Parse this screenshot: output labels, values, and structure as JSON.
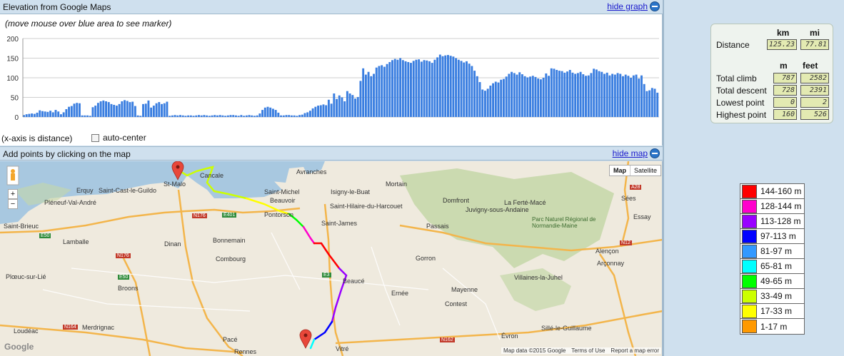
{
  "elevation_panel": {
    "title": "Elevation from Google Maps",
    "hide_link": "hide graph",
    "hint": "(move mouse over blue area to see marker)",
    "xaxis_note": "(x-axis is distance)",
    "autocenter_label": "auto-center",
    "autocenter_checked": false
  },
  "map_panel": {
    "title": "Add points by clicking on the map",
    "hide_link": "hide map",
    "map_type_buttons": [
      "Map",
      "Satellite"
    ],
    "attribution": [
      "Map data ©2015 Google",
      "Terms of Use",
      "Report a map error"
    ],
    "google_logo": "Google",
    "zoom_in": "+",
    "zoom_out": "−",
    "place_labels": [
      "St-Malo",
      "Cancale",
      "Avranches",
      "Mortain",
      "Erquy",
      "Saint-Cast-le-Guildo",
      "Pléneuf-Val-André",
      "Saint-Michel",
      "Beauvoir",
      "Isigny-le-Buat",
      "Saint-Hilaire-du-Harcouet",
      "Domfront",
      "La Ferté-Macé",
      "Juvigny-sous-Andaine",
      "Parc Naturel Régional de Normandie-Maine",
      "Sées",
      "Essay",
      "Saint-Brieuc",
      "Lamballe",
      "Dinan",
      "Bonnemain",
      "Pontorson",
      "Saint-James",
      "Passais",
      "Combourg",
      "Gorron",
      "Alençon",
      "Arçonnay",
      "Plœuc-sur-Lié",
      "Broons",
      "Beaucé",
      "Ernée",
      "Villaines-la-Juhel",
      "Mayenne",
      "Contest",
      "Loudéac",
      "Merdrignac",
      "Pacé",
      "Rennes",
      "Vitré",
      "Évron",
      "Sillé-le-Guillaume"
    ],
    "road_labels": [
      "N176",
      "E401",
      "E50",
      "N176",
      "E50",
      "N164",
      "E3",
      "N162",
      "A28",
      "N12"
    ]
  },
  "stats": {
    "headers1": [
      "km",
      "mi"
    ],
    "distance_label": "Distance",
    "distance_km": "125.23",
    "distance_mi": "77.81",
    "headers2": [
      "m",
      "feet"
    ],
    "rows": [
      {
        "label": "Total climb",
        "m": "787",
        "feet": "2582"
      },
      {
        "label": "Total descent",
        "m": "728",
        "feet": "2391"
      },
      {
        "label": "Lowest point",
        "m": "0",
        "feet": "2"
      },
      {
        "label": "Highest point",
        "m": "160",
        "feet": "526"
      }
    ]
  },
  "legend": [
    {
      "label": "144-160 m",
      "color": "#ff0000"
    },
    {
      "label": "128-144 m",
      "color": "#ff00cc"
    },
    {
      "label": "113-128 m",
      "color": "#9900ff"
    },
    {
      "label": "97-113 m",
      "color": "#0000ff"
    },
    {
      "label": "81-97 m",
      "color": "#3399ff"
    },
    {
      "label": "65-81 m",
      "color": "#00ffff"
    },
    {
      "label": "49-65 m",
      "color": "#00ff00"
    },
    {
      "label": "33-49 m",
      "color": "#ccff00"
    },
    {
      "label": "17-33 m",
      "color": "#ffff00"
    },
    {
      "label": "1-17 m",
      "color": "#ff9900"
    }
  ],
  "chart_data": {
    "type": "bar",
    "ylim": [
      0,
      200
    ],
    "yticks": [
      0,
      50,
      100,
      150,
      200
    ],
    "grid": true,
    "bar_color": "#3a7ee0",
    "values": [
      5,
      7,
      8,
      9,
      8,
      11,
      17,
      15,
      14,
      13,
      16,
      12,
      18,
      14,
      7,
      12,
      20,
      26,
      28,
      34,
      36,
      35,
      4,
      4,
      4,
      3,
      25,
      29,
      36,
      40,
      42,
      40,
      38,
      33,
      31,
      29,
      33,
      40,
      43,
      41,
      38,
      39,
      28,
      4,
      3,
      33,
      34,
      42,
      24,
      29,
      35,
      38,
      33,
      35,
      39,
      3,
      4,
      5,
      4,
      5,
      4,
      3,
      4,
      4,
      3,
      4,
      5,
      4,
      5,
      4,
      3,
      4,
      5,
      4,
      5,
      4,
      3,
      4,
      5,
      5,
      4,
      3,
      5,
      3,
      4,
      5,
      4,
      3,
      4,
      9,
      18,
      24,
      26,
      24,
      21,
      18,
      11,
      4,
      4,
      5,
      5,
      4,
      4,
      3,
      5,
      6,
      10,
      12,
      16,
      22,
      26,
      29,
      30,
      32,
      30,
      44,
      34,
      60,
      46,
      55,
      50,
      40,
      66,
      60,
      56,
      47,
      51,
      92,
      124,
      108,
      115,
      104,
      110,
      126,
      130,
      132,
      128,
      135,
      140,
      145,
      148,
      146,
      150,
      145,
      142,
      140,
      138,
      143,
      146,
      147,
      141,
      145,
      144,
      142,
      138,
      146,
      152,
      159,
      155,
      157,
      158,
      156,
      154,
      150,
      146,
      143,
      139,
      142,
      136,
      130,
      118,
      104,
      89,
      70,
      67,
      72,
      80,
      86,
      90,
      88,
      95,
      97,
      103,
      110,
      115,
      112,
      108,
      114,
      109,
      104,
      101,
      103,
      105,
      102,
      98,
      96,
      100,
      111,
      105,
      124,
      123,
      120,
      118,
      117,
      113,
      116,
      120,
      113,
      110,
      112,
      115,
      109,
      105,
      106,
      112,
      123,
      121,
      117,
      115,
      110,
      113,
      106,
      110,
      108,
      112,
      110,
      104,
      108,
      105,
      100,
      106,
      108,
      98,
      106,
      84,
      66,
      68,
      74,
      72,
      62
    ]
  }
}
